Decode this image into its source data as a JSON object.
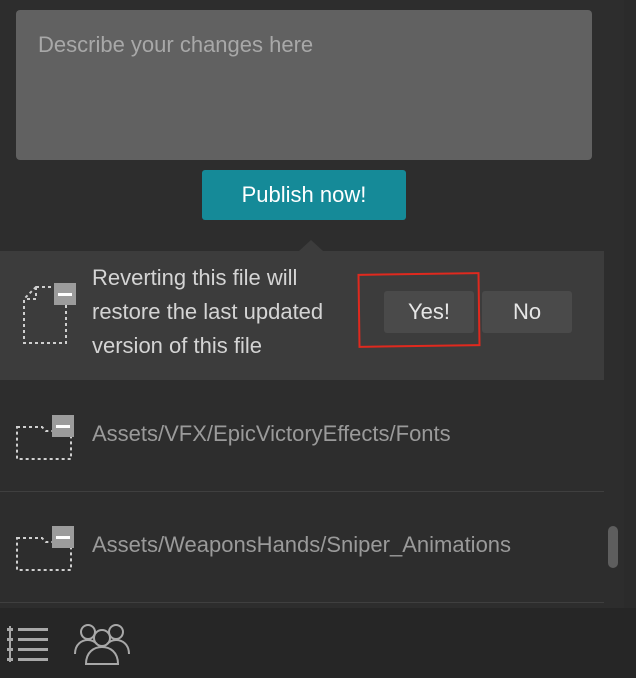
{
  "publish": {
    "placeholder": "Describe your changes here",
    "button_label": "Publish now!"
  },
  "revert_confirm": {
    "message": "Reverting this file will restore the last updated version of this file",
    "yes_label": "Yes!",
    "no_label": "No"
  },
  "files": [
    {
      "path": "Assets/VFX/EpicVictoryEffects/Fonts",
      "icon": "folder-removed-icon"
    },
    {
      "path": "Assets/WeaponsHands/Sniper_Animations",
      "icon": "folder-removed-icon"
    }
  ],
  "bottom_bar": {
    "icons": [
      "list-view-icon",
      "users-icon"
    ]
  },
  "colors": {
    "accent": "#158a98",
    "highlight": "#e0291e"
  }
}
